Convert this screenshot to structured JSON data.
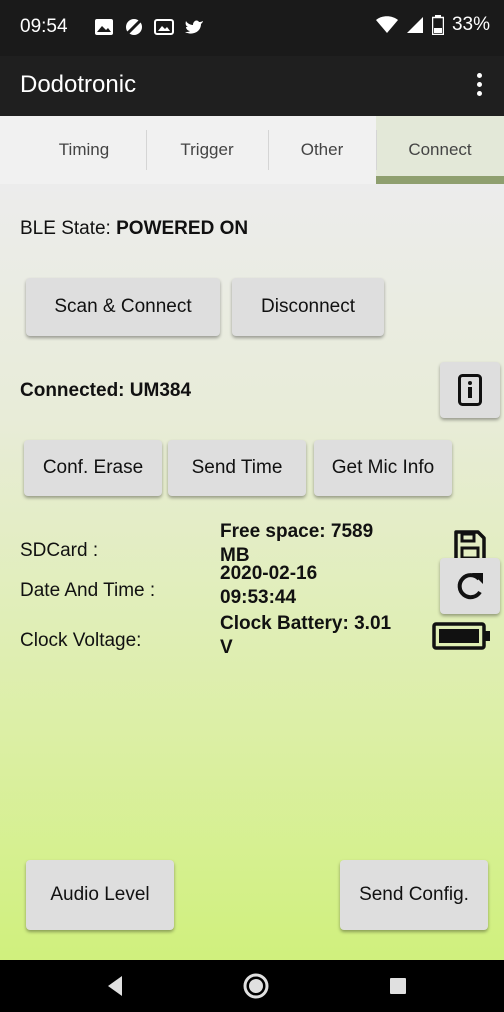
{
  "status_bar": {
    "time": "09:54",
    "battery": "33%",
    "icons": [
      "image-icon",
      "sync-off-icon",
      "gallery-icon",
      "twitter-icon",
      "wifi-icon",
      "signal-icon",
      "battery-icon"
    ]
  },
  "app": {
    "title": "Dodotronic"
  },
  "tabs": [
    {
      "label": "Timing"
    },
    {
      "label": "Trigger"
    },
    {
      "label": "Other"
    },
    {
      "label": "Connect",
      "active": true
    }
  ],
  "ble": {
    "label": "BLE State:",
    "value": "POWERED ON"
  },
  "buttons": {
    "scan": "Scan & Connect",
    "disconnect": "Disconnect",
    "conf_erase": "Conf. Erase",
    "send_time": "Send Time",
    "get_mic_info": "Get Mic Info",
    "audio_level": "Audio Level",
    "send_config": "Send Config."
  },
  "connected": {
    "text": "Connected: UM384"
  },
  "sdcard": {
    "label": "SDCard :",
    "value_line1": "Free space: 7589",
    "value_line2": "MB"
  },
  "datetime": {
    "label": "Date And Time :",
    "value_line1": "2020-02-16",
    "value_line2": "09:53:44"
  },
  "clock": {
    "label": "Clock Voltage:",
    "value_line1": "Clock Battery: 3.01",
    "value_line2": "V"
  },
  "colors": {
    "appbar": "#1f1f1f",
    "tab_active": "#e3e8d8",
    "tab_indicator": "#8f9f6f",
    "gradient_bottom": "#d0f07d"
  }
}
